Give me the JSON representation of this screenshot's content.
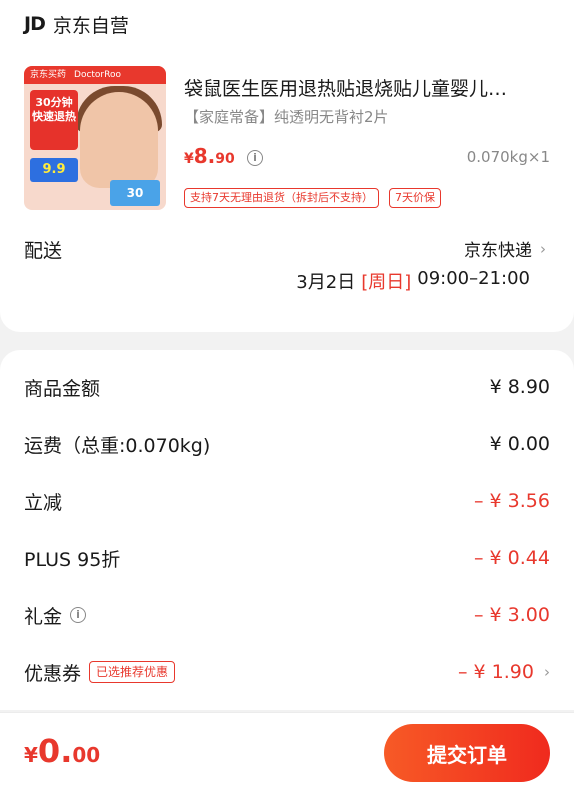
{
  "shop": {
    "logo": "JD",
    "name": "京东自营"
  },
  "product": {
    "thumbnail": {
      "brand_left": "京东买药",
      "brand_right": "DoctorRoo",
      "badge_line1": "30分钟",
      "badge_line2": "快速退热",
      "price_tag": "9.9",
      "box_text": "30"
    },
    "title": "袋鼠医生医用退热贴退烧贴儿童婴儿…",
    "subtitle": "【家庭常备】纯透明无背衬2片",
    "price_yen": "¥",
    "price_int": "8.",
    "price_dec": "90",
    "qty": "0.070kg×1",
    "service_tags": [
      "支持7天无理由退货（拆封后不支持）",
      "7天价保"
    ]
  },
  "delivery": {
    "label": "配送",
    "method": "京东快递",
    "date": "3月2日",
    "weekday": "[周日]",
    "time": "09:00–21:00"
  },
  "fees": {
    "goods_label": "商品金额",
    "goods_value": "¥ 8.90",
    "shipping_label": "运费（总重:0.070kg)",
    "shipping_value": "¥ 0.00",
    "discount_label": "立减",
    "discount_value": "– ¥ 3.56",
    "plus_label": "PLUS 95折",
    "plus_value": "– ¥ 0.44",
    "gift_label": "礼金",
    "gift_value": "– ¥ 3.00",
    "coupon_label": "优惠券",
    "coupon_tag": "已选推荐优惠",
    "coupon_value": "– ¥ 1.90"
  },
  "bottom": {
    "total_yen": "¥",
    "total_int": "0.",
    "total_dec": "00",
    "submit_label": "提交订单"
  },
  "colors": {
    "accent": "#e8382d",
    "button_start": "#f75a26",
    "button_end": "#f02a1e"
  },
  "icons": {
    "info": "info-circle-icon",
    "chevron": "chevron-right-icon"
  }
}
